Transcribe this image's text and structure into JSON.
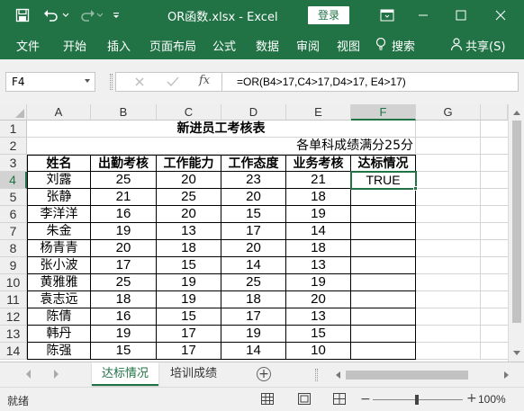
{
  "titlebar": {
    "title": "OR函数.xlsx  -  Excel",
    "login_label": "登录"
  },
  "ribbon": {
    "tabs": [
      "文件",
      "开始",
      "插入",
      "页面布局",
      "公式",
      "数据",
      "审阅",
      "视图"
    ],
    "search_label": "搜索",
    "share_label": "共享(S)"
  },
  "formula_bar": {
    "name_box": "F4",
    "formula": "=OR(B4>17,C4>17,D4>17, E4>17)",
    "fx_label": "fx"
  },
  "grid": {
    "columns": [
      "A",
      "B",
      "C",
      "D",
      "E",
      "F",
      "G"
    ],
    "rows": [
      "1",
      "2",
      "3",
      "4",
      "5",
      "6",
      "7",
      "8",
      "9",
      "10",
      "11",
      "12",
      "13",
      "14"
    ],
    "title": "新进员工考核表",
    "subtitle": "各单科成绩满分25分",
    "headers": [
      "姓名",
      "出勤考核",
      "工作能力",
      "工作态度",
      "业务考核",
      "达标情况"
    ],
    "data": [
      [
        "刘露",
        "25",
        "20",
        "23",
        "21",
        "TRUE"
      ],
      [
        "张静",
        "21",
        "25",
        "20",
        "18",
        ""
      ],
      [
        "李洋洋",
        "16",
        "20",
        "15",
        "19",
        ""
      ],
      [
        "朱金",
        "19",
        "13",
        "17",
        "14",
        ""
      ],
      [
        "杨青青",
        "20",
        "18",
        "20",
        "18",
        ""
      ],
      [
        "张小波",
        "17",
        "15",
        "14",
        "13",
        ""
      ],
      [
        "黄雅雅",
        "25",
        "19",
        "25",
        "19",
        ""
      ],
      [
        "袁志远",
        "18",
        "19",
        "18",
        "20",
        ""
      ],
      [
        "陈倩",
        "16",
        "15",
        "17",
        "13",
        ""
      ],
      [
        "韩丹",
        "19",
        "17",
        "19",
        "15",
        ""
      ],
      [
        "陈强",
        "15",
        "17",
        "14",
        "10",
        ""
      ]
    ]
  },
  "sheets": {
    "active": "达标情况",
    "other": "培训成绩"
  },
  "status": {
    "text": "就绪",
    "zoom": "100%"
  },
  "colors": {
    "accent": "#217346",
    "chrome_bg": "#f0f0f0"
  }
}
